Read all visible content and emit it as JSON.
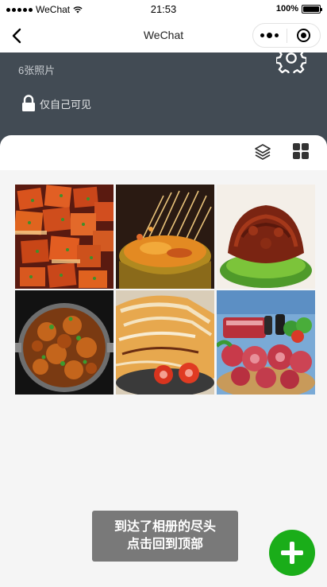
{
  "status_bar": {
    "carrier": "WeChat",
    "time": "21:53",
    "battery": "100%",
    "battery_level": 1.0
  },
  "nav": {
    "title": "WeChat",
    "back_icon": "chevron-left-icon",
    "more_icon": "more-dots-icon",
    "close_icon": "close-miniprogram-icon"
  },
  "album": {
    "title": "",
    "photo_count": "6张照片",
    "privacy": "仅自己可见",
    "settings_icon": "gear-icon",
    "lock_icon": "lock-icon"
  },
  "toolbar": {
    "layers_icon": "layers-icon",
    "grid_icon": "grid-view-icon"
  },
  "photos": [
    {
      "subject": "spicy grilled tofu"
    },
    {
      "subject": "skewers in pot"
    },
    {
      "subject": "braised meat on lettuce"
    },
    {
      "subject": "chicken curry in wok"
    },
    {
      "subject": "okonomiyaki with tomatoes"
    },
    {
      "subject": "raw meat platter"
    }
  ],
  "toast": {
    "line1": "到达了相册的尽头",
    "line2": "点击回到顶部"
  },
  "fab": {
    "icon": "plus-icon"
  },
  "colors": {
    "header_bg": "#424b54",
    "page_bg": "#f5f5f5",
    "fab": "#1aad19",
    "toast_bg": "#6e6e6e"
  }
}
